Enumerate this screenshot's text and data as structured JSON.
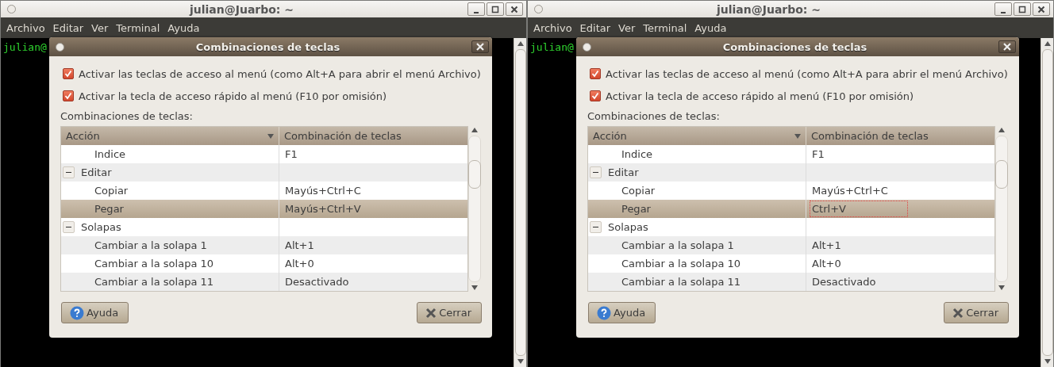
{
  "windows": [
    {
      "title": "julian@Juarbo: ~",
      "menu": [
        "Archivo",
        "Editar",
        "Ver",
        "Terminal",
        "Ayuda"
      ],
      "prompt": "julian@",
      "dialog": {
        "title": "Combinaciones de teclas",
        "checkboxes": [
          {
            "label": "Activar las teclas de acceso al menú (como Alt+A para abrir el menú Archivo)",
            "checked": true
          },
          {
            "label": "Activar la tecla de acceso rápido al menú (F10 por omisión)",
            "checked": true
          }
        ],
        "table_label": "Combinaciones de teclas:",
        "columns": [
          "Acción",
          "Combinación de teclas"
        ],
        "rows": [
          {
            "children": [
              {
                "action": "Indice",
                "shortcut": "F1",
                "selected": false,
                "editing": false
              }
            ]
          },
          {
            "action": "Editar",
            "expanded": true,
            "selected": false,
            "children": [
              {
                "action": "Copiar",
                "shortcut": "Mayús+Ctrl+C",
                "selected": false,
                "editing": false
              },
              {
                "action": "Pegar",
                "shortcut": "Mayús+Ctrl+V",
                "selected": true,
                "editing": false
              }
            ]
          },
          {
            "action": "Solapas",
            "expanded": true,
            "selected": false,
            "children": [
              {
                "action": "Cambiar a la solapa 1",
                "shortcut": "Alt+1",
                "selected": false,
                "editing": false
              },
              {
                "action": "Cambiar a la solapa 10",
                "shortcut": "Alt+0",
                "selected": false,
                "editing": false
              },
              {
                "action": "Cambiar a la solapa 11",
                "shortcut": "Desactivado",
                "selected": false,
                "editing": false
              }
            ]
          }
        ],
        "buttons": [
          {
            "label": "Ayuda",
            "kind": "help"
          },
          {
            "label": "Cerrar",
            "kind": "close"
          }
        ]
      }
    },
    {
      "title": "julian@Juarbo: ~",
      "menu": [
        "Archivo",
        "Editar",
        "Ver",
        "Terminal",
        "Ayuda"
      ],
      "prompt": "julian@",
      "dialog": {
        "title": "Combinaciones de teclas",
        "checkboxes": [
          {
            "label": "Activar las teclas de acceso al menú (como Alt+A para abrir el menú Archivo)",
            "checked": true
          },
          {
            "label": "Activar la tecla de acceso rápido al menú (F10 por omisión)",
            "checked": true
          }
        ],
        "table_label": "Combinaciones de teclas:",
        "columns": [
          "Acción",
          "Combinación de teclas"
        ],
        "rows": [
          {
            "children": [
              {
                "action": "Indice",
                "shortcut": "F1",
                "selected": false,
                "editing": false
              }
            ]
          },
          {
            "action": "Editar",
            "expanded": true,
            "selected": false,
            "children": [
              {
                "action": "Copiar",
                "shortcut": "Mayús+Ctrl+C",
                "selected": false,
                "editing": false
              },
              {
                "action": "Pegar",
                "shortcut": "Ctrl+V",
                "selected": true,
                "editing": true
              }
            ]
          },
          {
            "action": "Solapas",
            "expanded": true,
            "selected": false,
            "children": [
              {
                "action": "Cambiar a la solapa 1",
                "shortcut": "Alt+1",
                "selected": false,
                "editing": false
              },
              {
                "action": "Cambiar a la solapa 10",
                "shortcut": "Alt+0",
                "selected": false,
                "editing": false
              },
              {
                "action": "Cambiar a la solapa 11",
                "shortcut": "Desactivado",
                "selected": false,
                "editing": false
              }
            ]
          }
        ],
        "buttons": [
          {
            "label": "Ayuda",
            "kind": "help"
          },
          {
            "label": "Cerrar",
            "kind": "close"
          }
        ]
      }
    }
  ]
}
